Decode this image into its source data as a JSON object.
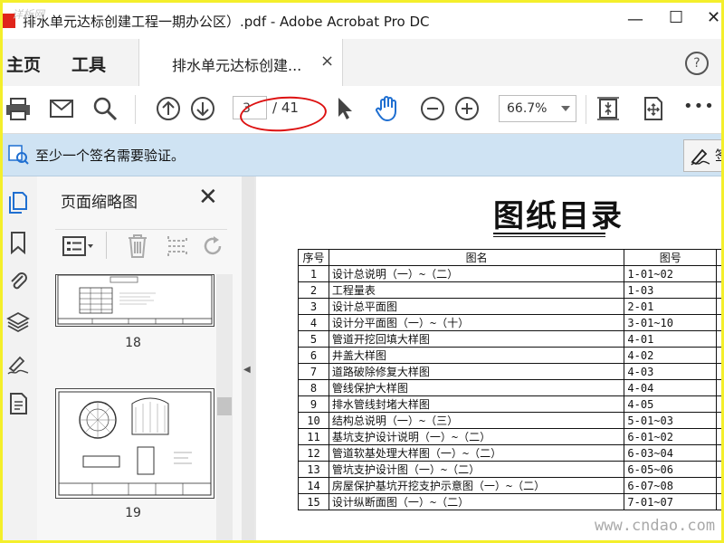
{
  "window": {
    "title": "排水单元达标创建工程一期办公区）.pdf - Adobe Acrobat Pro DC",
    "watermark": "详析网"
  },
  "nav": {
    "home": "主页",
    "tools": "工具"
  },
  "tab": {
    "label": "排水单元达标创建...",
    "close": "×"
  },
  "toolbar": {
    "page_current": "3",
    "page_total": "/ 41",
    "zoom": "66.7%",
    "more": "•••"
  },
  "signature": {
    "message": "至少一个签名需要验证。",
    "button": "签"
  },
  "thumbnails": {
    "title": "页面缩略图",
    "pages": [
      "18",
      "19"
    ]
  },
  "document": {
    "title": "图纸目录",
    "headers": [
      "序号",
      "图名",
      "图号"
    ],
    "rows": [
      [
        "1",
        "设计总说明（一）~（二）",
        "1-01~02"
      ],
      [
        "2",
        "工程量表",
        "1-03"
      ],
      [
        "3",
        "设计总平面图",
        "2-01"
      ],
      [
        "4",
        "设计分平面图（一）~（十）",
        "3-01~10"
      ],
      [
        "5",
        "管道开挖回填大样图",
        "4-01"
      ],
      [
        "6",
        "井盖大样图",
        "4-02"
      ],
      [
        "7",
        "道路破除修复大样图",
        "4-03"
      ],
      [
        "8",
        "管线保护大样图",
        "4-04"
      ],
      [
        "9",
        "排水管线封堵大样图",
        "4-05"
      ],
      [
        "10",
        "结构总说明（一）~（三）",
        "5-01~03"
      ],
      [
        "11",
        "基坑支护设计说明（一）~（二）",
        "6-01~02"
      ],
      [
        "12",
        "管道软基处理大样图（一）~（二）",
        "6-03~04"
      ],
      [
        "13",
        "管坑支护设计图（一）~（二）",
        "6-05~06"
      ],
      [
        "14",
        "房屋保护基坑开挖支护示意图（一）~（二）",
        "6-07~08"
      ],
      [
        "15",
        "设计纵断面图（一）~（二）",
        "7-01~07"
      ]
    ]
  },
  "site": "www.cndao.com",
  "colors": {
    "frame": "#f4ef2b",
    "sigbar": "#cfe3f3",
    "annotation": "#d11111",
    "accent": "#1f6fd1"
  }
}
